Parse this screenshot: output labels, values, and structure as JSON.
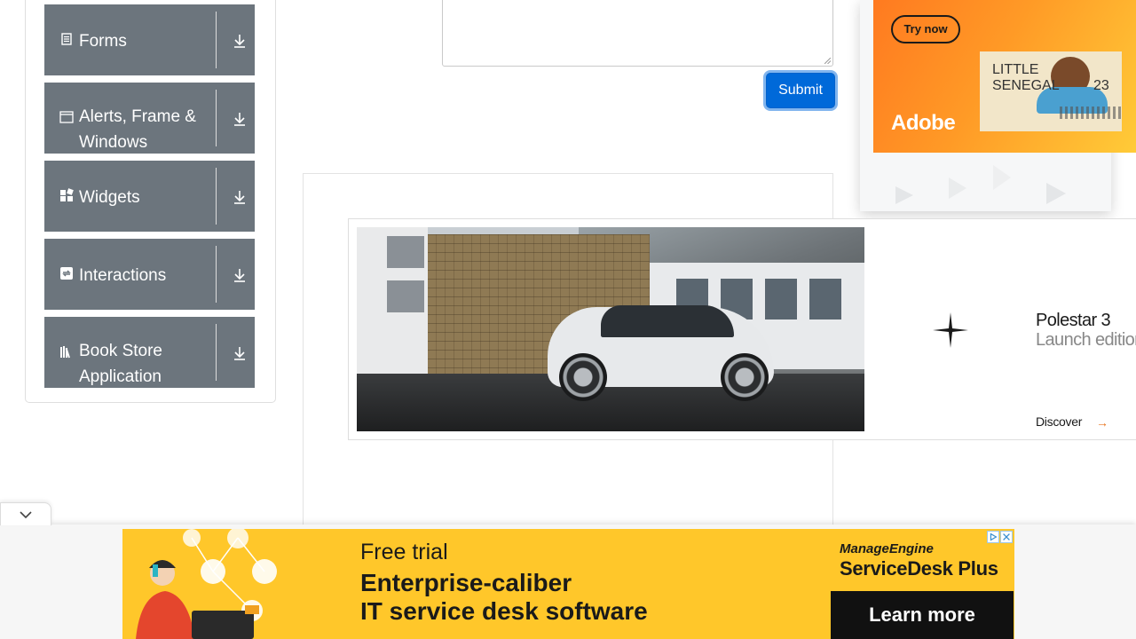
{
  "sidebar": {
    "groups": [
      {
        "label": "Forms",
        "icon": "document-icon"
      },
      {
        "label": "Alerts, Frame & Windows",
        "icon": "window-icon"
      },
      {
        "label": "Widgets",
        "icon": "widgets-icon"
      },
      {
        "label": "Interactions",
        "icon": "interactions-icon"
      },
      {
        "label": "Book Store Application",
        "icon": "books-icon"
      }
    ]
  },
  "form": {
    "submit_label": "Submit"
  },
  "right_ad": {
    "cta": "Try now",
    "brand": "Adobe",
    "tile_text": "LITTLE SENEGAL",
    "tile_number": "23"
  },
  "car_ad": {
    "name": "Polestar 3",
    "subtitle": "Launch edition",
    "cta": "Discover",
    "arrow": "→"
  },
  "bottom_ad": {
    "line0": "Free trial",
    "line1": "Enterprise-caliber",
    "line2": "IT service desk software",
    "brand": "ManageEngine",
    "product": "ServiceDesk Plus",
    "cta": "Learn more"
  },
  "colors": {
    "sidebar_group_bg": "#6c757d",
    "submit_bg": "#0069d9",
    "bottom_ad_bg": "#ffc72a",
    "adobe_orange": "#ff7a20"
  }
}
